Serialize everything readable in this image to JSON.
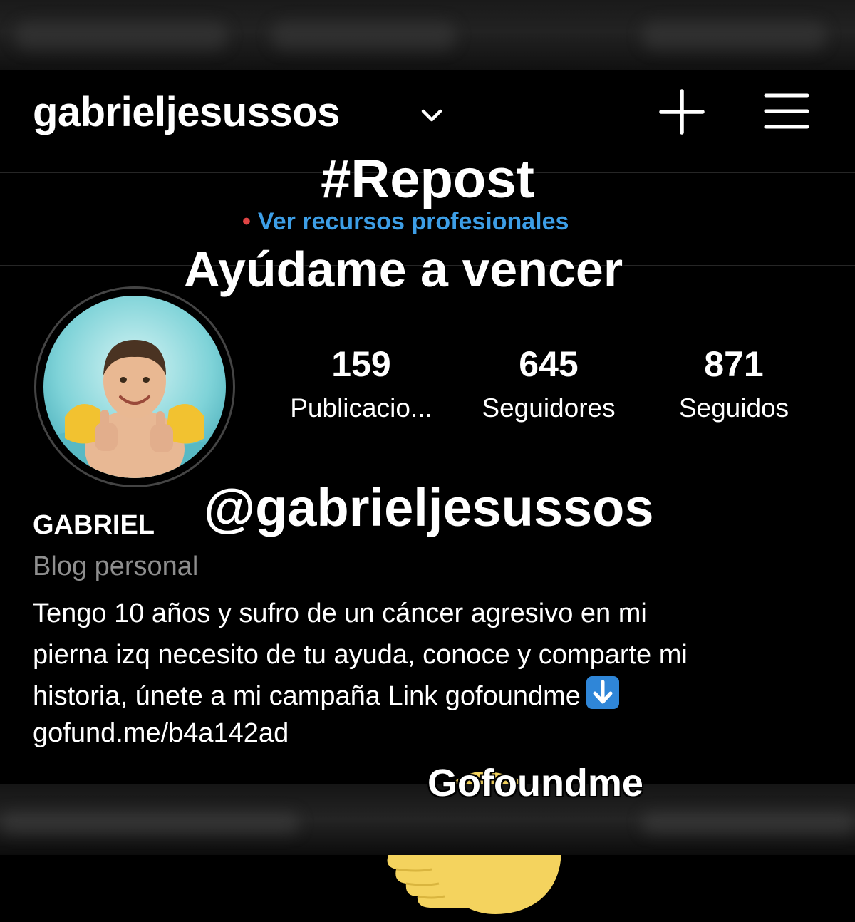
{
  "header": {
    "username": "gabrieljesussos"
  },
  "overlays": {
    "repost": "#Repost",
    "headline": "Ayúdame a vencer",
    "handle": "@gabrieljesussos",
    "caption": "Gofoundme"
  },
  "professional_link": {
    "label": "Ver recursos profesionales"
  },
  "stats": [
    {
      "value": "159",
      "label": "Publicacio..."
    },
    {
      "value": "645",
      "label": "Seguidores"
    },
    {
      "value": "871",
      "label": "Seguidos"
    }
  ],
  "profile": {
    "name": "GABRIEL",
    "category": "Blog personal",
    "bio_lines": [
      "Tengo 10 años y sufro de un cáncer agresivo en mi",
      "pierna izq necesito de tu ayuda, conoce y comparte mi",
      "historia, únete a mi campaña Link gofoundme"
    ],
    "link": "gofund.me/b4a142ad"
  },
  "icons": {
    "chevron": "chevron-down-icon",
    "plus": "plus-icon",
    "menu": "menu-icon",
    "arrow": "arrow-down-emoji",
    "hand": "pointing-hand-emoji"
  },
  "colors": {
    "background": "#000000",
    "link_blue": "#3d9ee6",
    "dot_red": "#e04444",
    "muted_text": "#8e8e8e",
    "hand_yellow": "#f4d35e"
  }
}
